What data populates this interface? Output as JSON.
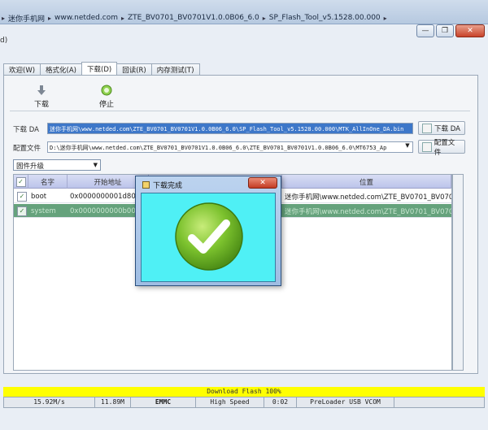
{
  "breadcrumb": [
    "迷你手机网",
    "www.netded.com",
    "ZTE_BV0701_BV0701V1.0.0B06_6.0",
    "SP_Flash_Tool_v5.1528.00.000"
  ],
  "window_buttons": {
    "minimize": "—",
    "restore": "❐",
    "close": "✕"
  },
  "menu_glyph": "d)",
  "tabs": [
    "欢迎(W)",
    "格式化(A)",
    "下载(D)",
    "回读(R)",
    "内存测试(T)"
  ],
  "active_tab": "下载(D)",
  "toolbar": {
    "download_label": "下载",
    "stop_label": "停止"
  },
  "fields": {
    "da_label": "下载 DA",
    "da_value": "迷你手机网\\www.netded.com\\ZTE_BV0701_BV0701V1.0.0B06_6.0\\SP_Flash_Tool_v5.1528.00.000\\MTK_AllInOne_DA.bin",
    "scatter_label": "配置文件",
    "scatter_value": "D:\\迷你手机网\\www.netded.com\\ZTE_BV0701_BV0701V1.0.0B06_6.0\\ZTE_BV0701_BV0701V1.0.0B06_6.0\\MT6753_Ap",
    "da_button": "下载 DA",
    "scatter_button": "配置文件"
  },
  "mode_select": "固件升级",
  "table": {
    "headers": [
      "名字",
      "开始地址",
      "位置"
    ],
    "rows": [
      {
        "checked": true,
        "name": "boot",
        "address": "0x0000000001d80000",
        "location": "迷你手机网\\www.netded.com\\ZTE_BV0701_BV0701V..."
      },
      {
        "checked": true,
        "name": "system",
        "address": "0x0000000000b000000",
        "location": "迷你手机网\\www.netded.com\\ZTE_BV0701_BV0701V..."
      }
    ]
  },
  "dialog": {
    "title": "下载完成",
    "close": "✕"
  },
  "progress_text": "Download Flash 100%",
  "status": [
    "15.92M/s",
    "11.89M",
    "EMMC",
    "High Speed",
    "0:02",
    "PreLoader USB VCOM"
  ],
  "colors": {
    "progress": "#ffff00",
    "dialog_body": "#4ff0f5",
    "selected_row": "#65a27c",
    "check_green": "#6fb52c"
  }
}
